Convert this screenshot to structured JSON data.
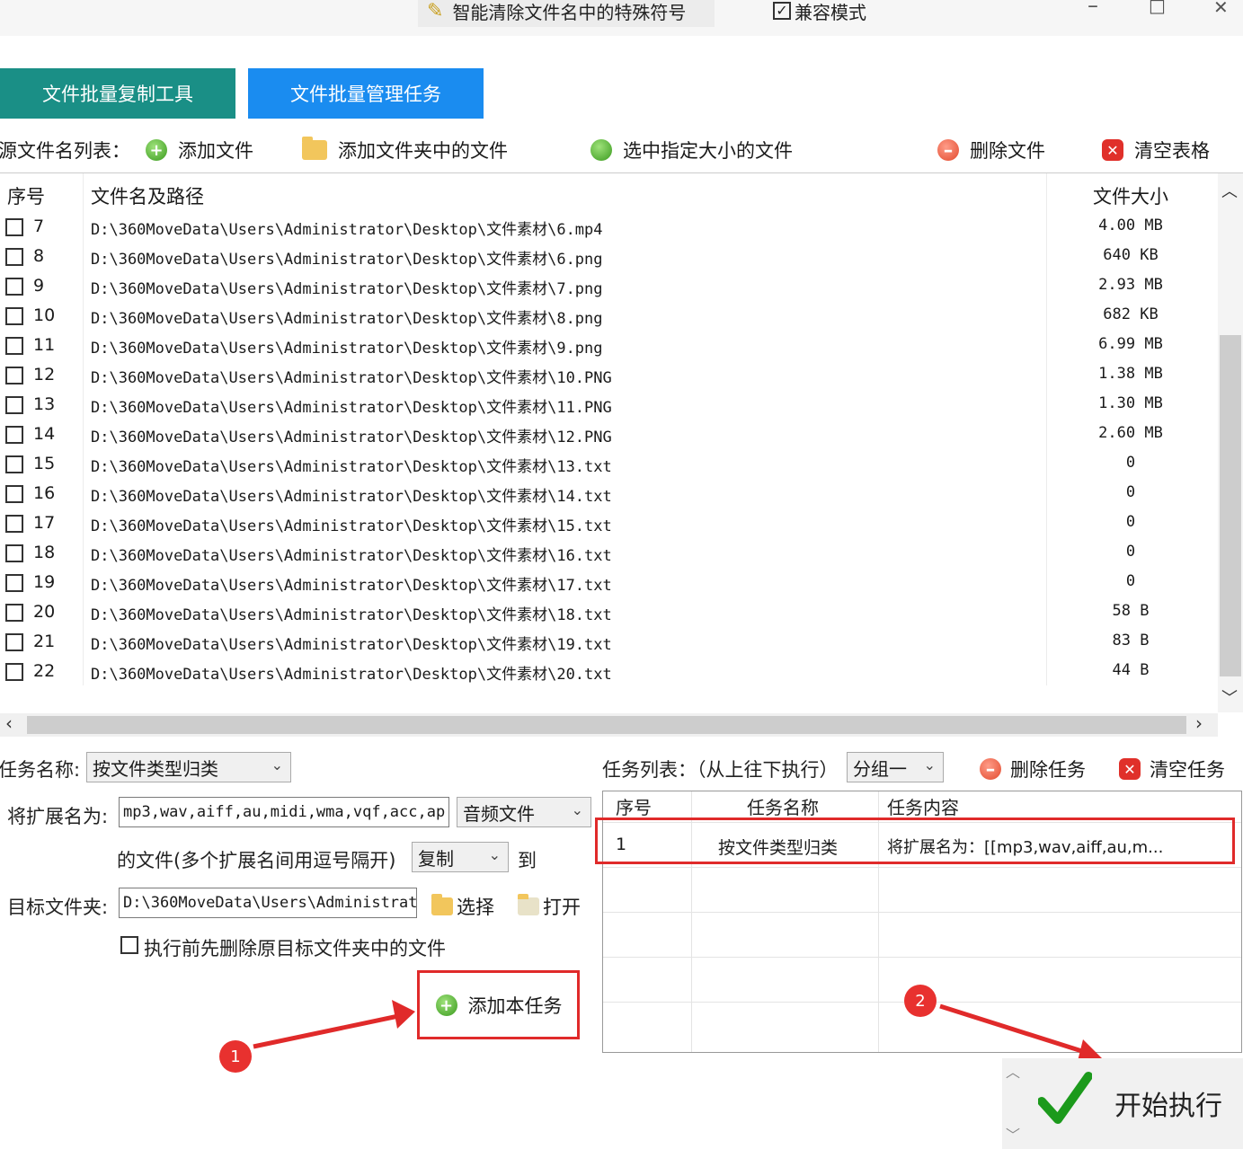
{
  "titlebar": {
    "smart_clean": "智能清除文件名中的特殊符号",
    "compat_mode": "兼容模式",
    "compat_checked": true,
    "minimize": "–",
    "maximize": "□",
    "close": "✕"
  },
  "tabs": [
    {
      "label": "文件批量复制工具",
      "active": false
    },
    {
      "label": "文件批量管理任务",
      "active": true
    }
  ],
  "toolbar": {
    "list_label": "源文件名列表：",
    "add_file": "添加文件",
    "add_folder_files": "添加文件夹中的文件",
    "select_by_size": "选中指定大小的文件",
    "delete_file": "删除文件",
    "clear_table": "清空表格"
  },
  "file_table": {
    "headers": {
      "index": "序号",
      "path": "文件名及路径",
      "size": "文件大小"
    },
    "rows": [
      {
        "index": "7",
        "path": "D:\\360MoveData\\Users\\Administrator\\Desktop\\文件素材\\6.mp4",
        "size": "4.00 MB",
        "checked": false
      },
      {
        "index": "8",
        "path": "D:\\360MoveData\\Users\\Administrator\\Desktop\\文件素材\\6.png",
        "size": "640 KB",
        "checked": false
      },
      {
        "index": "9",
        "path": "D:\\360MoveData\\Users\\Administrator\\Desktop\\文件素材\\7.png",
        "size": "2.93 MB",
        "checked": false
      },
      {
        "index": "10",
        "path": "D:\\360MoveData\\Users\\Administrator\\Desktop\\文件素材\\8.png",
        "size": "682 KB",
        "checked": false
      },
      {
        "index": "11",
        "path": "D:\\360MoveData\\Users\\Administrator\\Desktop\\文件素材\\9.png",
        "size": "6.99 MB",
        "checked": false
      },
      {
        "index": "12",
        "path": "D:\\360MoveData\\Users\\Administrator\\Desktop\\文件素材\\10.PNG",
        "size": "1.38 MB",
        "checked": false
      },
      {
        "index": "13",
        "path": "D:\\360MoveData\\Users\\Administrator\\Desktop\\文件素材\\11.PNG",
        "size": "1.30 MB",
        "checked": false
      },
      {
        "index": "14",
        "path": "D:\\360MoveData\\Users\\Administrator\\Desktop\\文件素材\\12.PNG",
        "size": "2.60 MB",
        "checked": false
      },
      {
        "index": "15",
        "path": "D:\\360MoveData\\Users\\Administrator\\Desktop\\文件素材\\13.txt",
        "size": "0",
        "checked": false
      },
      {
        "index": "16",
        "path": "D:\\360MoveData\\Users\\Administrator\\Desktop\\文件素材\\14.txt",
        "size": "0",
        "checked": false
      },
      {
        "index": "17",
        "path": "D:\\360MoveData\\Users\\Administrator\\Desktop\\文件素材\\15.txt",
        "size": "0",
        "checked": false
      },
      {
        "index": "18",
        "path": "D:\\360MoveData\\Users\\Administrator\\Desktop\\文件素材\\16.txt",
        "size": "0",
        "checked": false
      },
      {
        "index": "19",
        "path": "D:\\360MoveData\\Users\\Administrator\\Desktop\\文件素材\\17.txt",
        "size": "0",
        "checked": false
      },
      {
        "index": "20",
        "path": "D:\\360MoveData\\Users\\Administrator\\Desktop\\文件素材\\18.txt",
        "size": "58 B",
        "checked": false
      },
      {
        "index": "21",
        "path": "D:\\360MoveData\\Users\\Administrator\\Desktop\\文件素材\\19.txt",
        "size": "83 B",
        "checked": false
      },
      {
        "index": "22",
        "path": "D:\\360MoveData\\Users\\Administrator\\Desktop\\文件素材\\20.txt",
        "size": "44 B",
        "checked": false
      }
    ]
  },
  "task_form": {
    "task_name_label": "任务名称:",
    "task_name_value": "按文件类型归类",
    "ext_label": "将扩展名为:",
    "ext_value": "mp3,wav,aiff,au,midi,wma,vqf,acc,ap",
    "ext_type_value": "音频文件",
    "ext_hint": "的文件(多个扩展名间用逗号隔开)",
    "action_value": "复制",
    "to_label": "到",
    "target_label": "目标文件夹:",
    "target_value": "D:\\360MoveData\\Users\\Administrat",
    "choose_btn": "选择",
    "open_btn": "打开",
    "predelete_label": "执行前先删除原目标文件夹中的文件",
    "predelete_checked": false,
    "add_task_btn": "添加本任务"
  },
  "task_list": {
    "label": "任务列表：（从上往下执行）",
    "group_value": "分组一",
    "delete_task": "删除任务",
    "clear_task": "清空任务",
    "headers": {
      "index": "序号",
      "name": "任务名称",
      "content": "任务内容"
    },
    "rows": [
      {
        "index": "1",
        "name": "按文件类型归类",
        "content": "将扩展名为：[[mp3,wav,aiff,au,m..."
      }
    ]
  },
  "annotations": {
    "badge1": "1",
    "badge2": "2",
    "color": "#e02a2a"
  },
  "start_btn": "开始执行",
  "colors": {
    "tab_inactive": "#1a8f86",
    "tab_active": "#1a8cf0",
    "accent_red": "#e02a2a"
  }
}
